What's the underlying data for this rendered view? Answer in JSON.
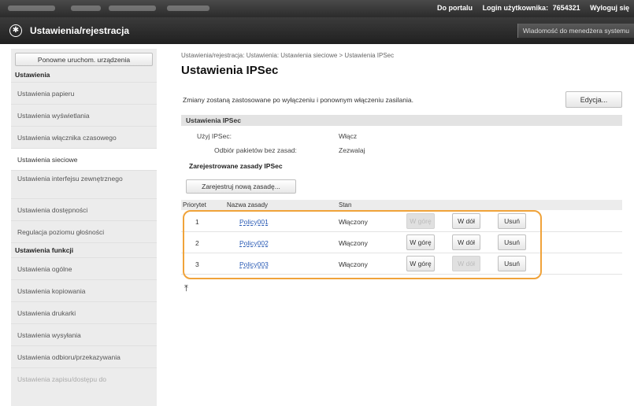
{
  "topbar": {
    "portal_link": "Do portalu",
    "login_label": "Login użytkownika:",
    "login_value": "7654321",
    "logout_link": "Wyloguj się"
  },
  "header": {
    "title": "Ustawienia/rejestracja",
    "system_message_link": "Wiadomość do menedżera systemu"
  },
  "sidebar": {
    "restart_button": "Ponowne uruchom. urządzenia",
    "section_settings": "Ustawienia",
    "items": [
      "Ustawienia papieru",
      "Ustawienia wyświetlania",
      "Ustawienia włącznika czasowego",
      "Ustawienia sieciowe",
      "Ustawienia interfejsu zewnętrznego",
      "Ustawienia dostępności",
      "Regulacja poziomu głośności"
    ],
    "section_functions": "Ustawienia funkcji",
    "items2": [
      "Ustawienia ogólne",
      "Ustawienia kopiowania",
      "Ustawienia drukarki",
      "Ustawienia wysyłania",
      "Ustawienia odbioru/przekazywania",
      "Ustawienia zapisu/dostępu do"
    ]
  },
  "main": {
    "breadcrumb": "Ustawienia/rejestracja: Ustawienia: Ustawienia sieciowe > Ustawienia IPSec",
    "title": "Ustawienia IPSec",
    "notice": "Zmiany zostaną zastosowane po wyłączeniu i ponownym włączeniu zasilania.",
    "edit_button": "Edycja...",
    "section_title": "Ustawienia IPSec",
    "use_ipsec_label": "Użyj IPSec:",
    "use_ipsec_value": "Włącz",
    "receive_label": "Odbiór pakietów bez zasad:",
    "receive_value": "Zezwalaj",
    "registered_title": "Zarejestrowane zasady IPSec",
    "register_button": "Zarejestruj nową zasadę...",
    "columns": [
      "Priorytet",
      "Nazwa zasady",
      "Stan"
    ],
    "rows": [
      {
        "priority": "1",
        "name": "Policy001",
        "status": "Włączony",
        "up": "W górę",
        "down": "W dół",
        "delete": "Usuń",
        "up_disabled": true,
        "down_disabled": false
      },
      {
        "priority": "2",
        "name": "Policy002",
        "status": "Włączony",
        "up": "W górę",
        "down": "W dół",
        "delete": "Usuń",
        "up_disabled": false,
        "down_disabled": false
      },
      {
        "priority": "3",
        "name": "Policy003",
        "status": "Włączony",
        "up": "W górę",
        "down": "W dół",
        "delete": "Usuń",
        "up_disabled": false,
        "down_disabled": true
      }
    ],
    "highlight_color": "#f0a33a",
    "link_color": "#2a5bb5"
  }
}
